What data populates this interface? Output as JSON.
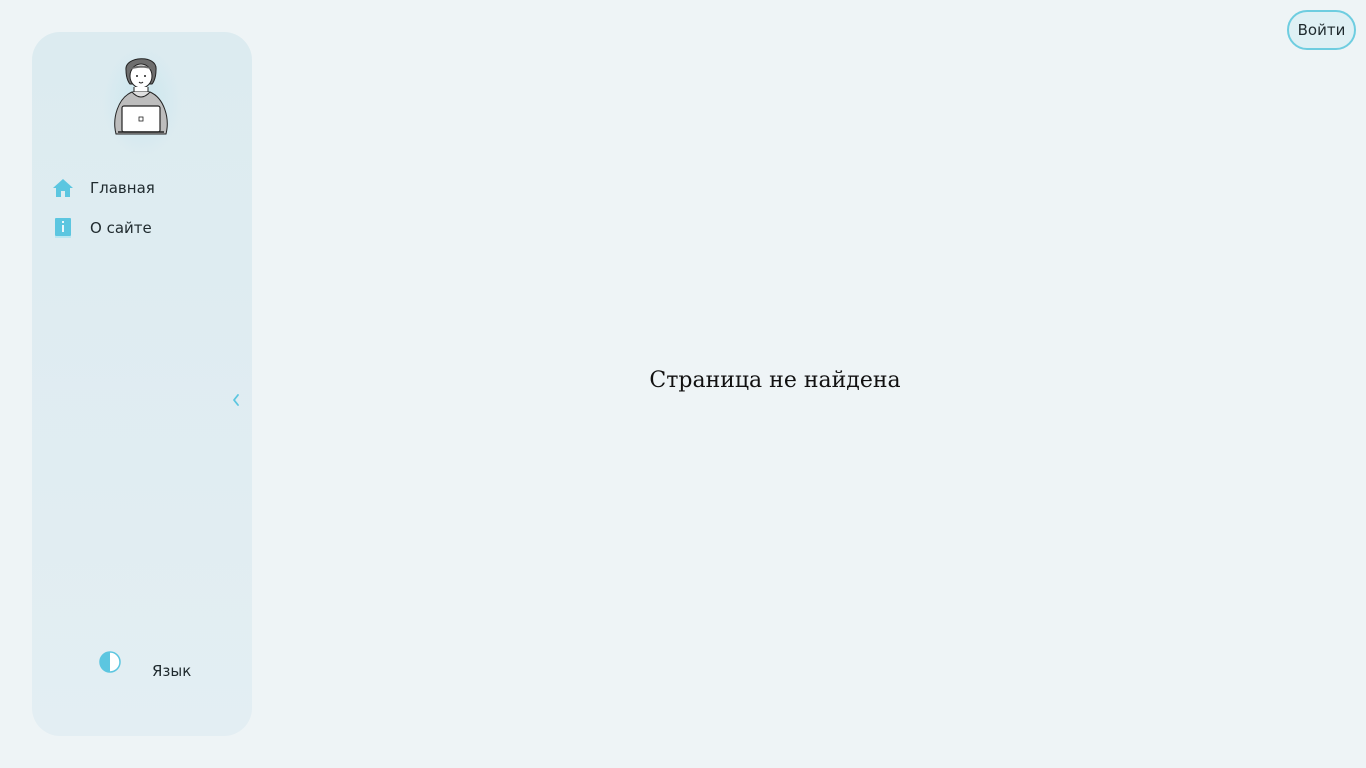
{
  "header": {
    "login_label": "Войти"
  },
  "sidebar": {
    "items": [
      {
        "label": "Главная",
        "icon": "home-icon"
      },
      {
        "label": "О сайте",
        "icon": "info-book-icon"
      }
    ],
    "collapse_icon": "chevron-left-icon",
    "theme_icon": "contrast-icon",
    "language_label": "Язык"
  },
  "main": {
    "message": "Страница не найдена"
  },
  "colors": {
    "accent": "#6ecde0",
    "icon": "#5cc6e0",
    "sidebar_bg": "#dfecf1",
    "page_bg": "#eef4f6"
  }
}
